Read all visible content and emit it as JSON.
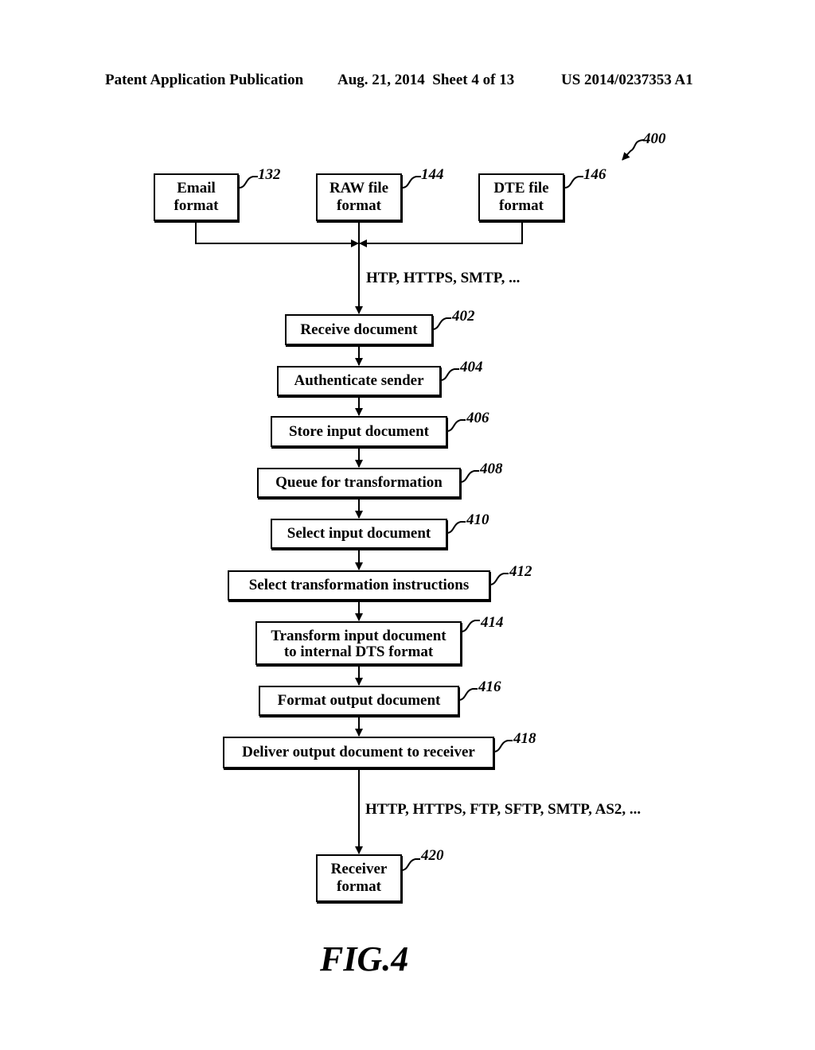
{
  "header": {
    "publication": "Patent Application Publication",
    "date_sheet": "Aug. 21, 2014  Sheet 4 of 13",
    "number": "US 2014/0237353 A1"
  },
  "figure_ref": "400",
  "inputs": [
    {
      "line1": "Email",
      "line2": "format",
      "ref": "132"
    },
    {
      "line1": "RAW file",
      "line2": "format",
      "ref": "144"
    },
    {
      "line1": "DTE file",
      "line2": "format",
      "ref": "146"
    }
  ],
  "input_protocols": "HTP, HTTPS, SMTP, ...",
  "steps": [
    {
      "label": "Receive document",
      "ref": "402"
    },
    {
      "label": "Authenticate sender",
      "ref": "404"
    },
    {
      "label": "Store input document",
      "ref": "406"
    },
    {
      "label": "Queue for transformation",
      "ref": "408"
    },
    {
      "label": "Select input document",
      "ref": "410"
    },
    {
      "label": "Select transformation instructions",
      "ref": "412"
    },
    {
      "label": "Transform input document",
      "label2": "to internal DTS format",
      "ref": "414"
    },
    {
      "label": "Format output document",
      "ref": "416"
    },
    {
      "label": "Deliver output document to receiver",
      "ref": "418"
    }
  ],
  "output_protocols": "HTTP, HTTPS, FTP, SFTP, SMTP, AS2, ...",
  "receiver": {
    "line1": "Receiver",
    "line2": "format",
    "ref": "420"
  },
  "caption": "FIG.4"
}
